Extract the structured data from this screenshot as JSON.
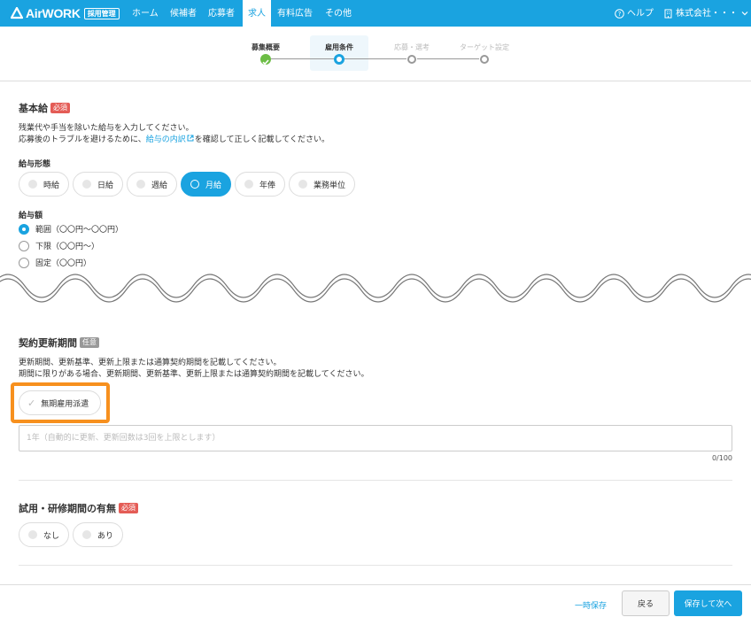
{
  "header": {
    "logo_text": "AirWORK",
    "logo_badge": "採用管理",
    "nav": [
      "ホーム",
      "候補者",
      "応募者",
      "求人",
      "有料広告",
      "その他"
    ],
    "active_nav": "求人",
    "help_label": "ヘルプ",
    "company_label": "株式会社・・・"
  },
  "steps": {
    "items": [
      {
        "label": "募集概要",
        "state": "done"
      },
      {
        "label": "雇用条件",
        "state": "current"
      },
      {
        "label": "応募・選考",
        "state": "todo"
      },
      {
        "label": "ターゲット設定",
        "state": "todo"
      }
    ]
  },
  "salary": {
    "title": "基本給",
    "badge": "必須",
    "desc_line1": "残業代や手当を除いた給与を入力してください。",
    "desc_line2_pre": "応募後のトラブルを避けるために、",
    "desc_link": "給与の内訳",
    "desc_line2_post": "を確認して正しく記載してください。",
    "type_label": "給与形態",
    "types": [
      "時給",
      "日給",
      "週給",
      "月給",
      "年俸",
      "業務単位"
    ],
    "selected_type": "月給",
    "amount_label": "給与額",
    "amount_options": [
      "範囲（〇〇円〜〇〇円）",
      "下限（〇〇円〜）",
      "固定（〇〇円）"
    ],
    "selected_amount": "範囲（〇〇円〜〇〇円）"
  },
  "contract": {
    "title": "契約更新期間",
    "badge": "任意",
    "desc_line1": "更新期間、更新基準、更新上限または通算契約期間を記載してください。",
    "desc_line2": "期間に限りがある場合、更新期間、更新基準、更新上限または通算契約期間を記載してください。",
    "checkbox_label": "無期雇用派遣",
    "input_placeholder": "1年（自動的に更新、更新回数は3回を上限とします）",
    "counter": "0/100"
  },
  "trial": {
    "title": "試用・研修期間の有無",
    "badge": "必須",
    "options": [
      "なし",
      "あり"
    ]
  },
  "footer": {
    "save_temp": "一時保存",
    "back": "戻る",
    "save_next": "保存して次へ"
  },
  "colors": {
    "brand": "#1aa3e0",
    "required": "#e45c56",
    "done": "#6cbd45",
    "highlight": "#f7901e"
  }
}
